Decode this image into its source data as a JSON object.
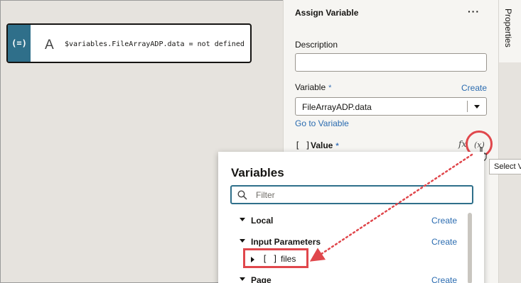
{
  "canvas": {
    "node_icon": "(=)",
    "node_letter": "A",
    "node_expression": "$variables.FileArrayADP.data = not defined"
  },
  "panel": {
    "title": "Assign Variable",
    "menu": "···",
    "description_label": "Description",
    "description_value": "",
    "variable_label": "Variable",
    "required_mark": "*",
    "create_link": "Create",
    "variable_value": "FileArrayADP.data",
    "go_to_variable": "Go to Variable",
    "value_bracket": "[ ]",
    "value_label": "Value",
    "fx_label": "fx",
    "variable_picker_label": "(x)"
  },
  "side_tab": {
    "label": "Properties"
  },
  "tooltip": {
    "text": "Select V"
  },
  "popup": {
    "title": "Variables",
    "filter_placeholder": "Filter",
    "rows": [
      {
        "name": "Local",
        "create": "Create"
      },
      {
        "name": "Input Parameters",
        "create": "Create"
      },
      {
        "name": "Page",
        "create": "Create"
      }
    ],
    "files_item": {
      "bracket": "[ ]",
      "name": "files"
    }
  },
  "colors": {
    "accent_link": "#2a6bb0",
    "highlight_red": "#e0474c",
    "node_icon_bg": "#2f6f8a"
  }
}
